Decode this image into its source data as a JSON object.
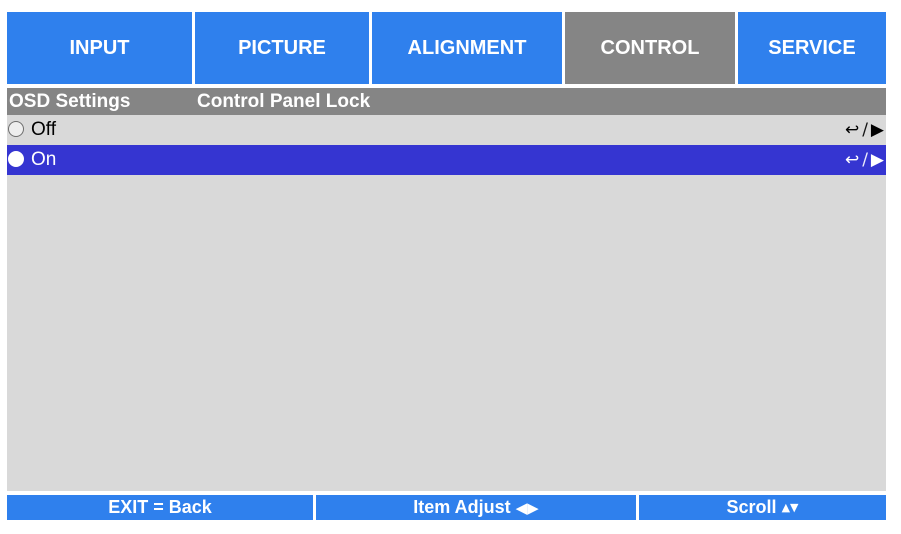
{
  "tabs": [
    {
      "label": "INPUT",
      "active": false
    },
    {
      "label": "PICTURE",
      "active": false
    },
    {
      "label": "ALIGNMENT",
      "active": false
    },
    {
      "label": "CONTROL",
      "active": true
    },
    {
      "label": "SERVICE",
      "active": false
    }
  ],
  "header": {
    "section": "OSD Settings",
    "title": "Control Panel Lock"
  },
  "options": [
    {
      "label": "Off",
      "selected": false,
      "hint_enter": "↩",
      "hint_sep": "/",
      "hint_arrow": "▶"
    },
    {
      "label": "On",
      "selected": true,
      "hint_enter": "↩",
      "hint_sep": "/",
      "hint_arrow": "▶"
    }
  ],
  "footer": {
    "exit": {
      "label": "EXIT = Back",
      "symbol": ""
    },
    "adjust": {
      "label": "Item Adjust",
      "symbol": "◀▶"
    },
    "scroll": {
      "label": "Scroll",
      "symbol": "▲▼"
    }
  },
  "colors": {
    "tab_blue": "#2f80ed",
    "tab_active_gray": "#858585",
    "highlight_row": "#3535d1",
    "content_bg": "#d9d9d9"
  }
}
